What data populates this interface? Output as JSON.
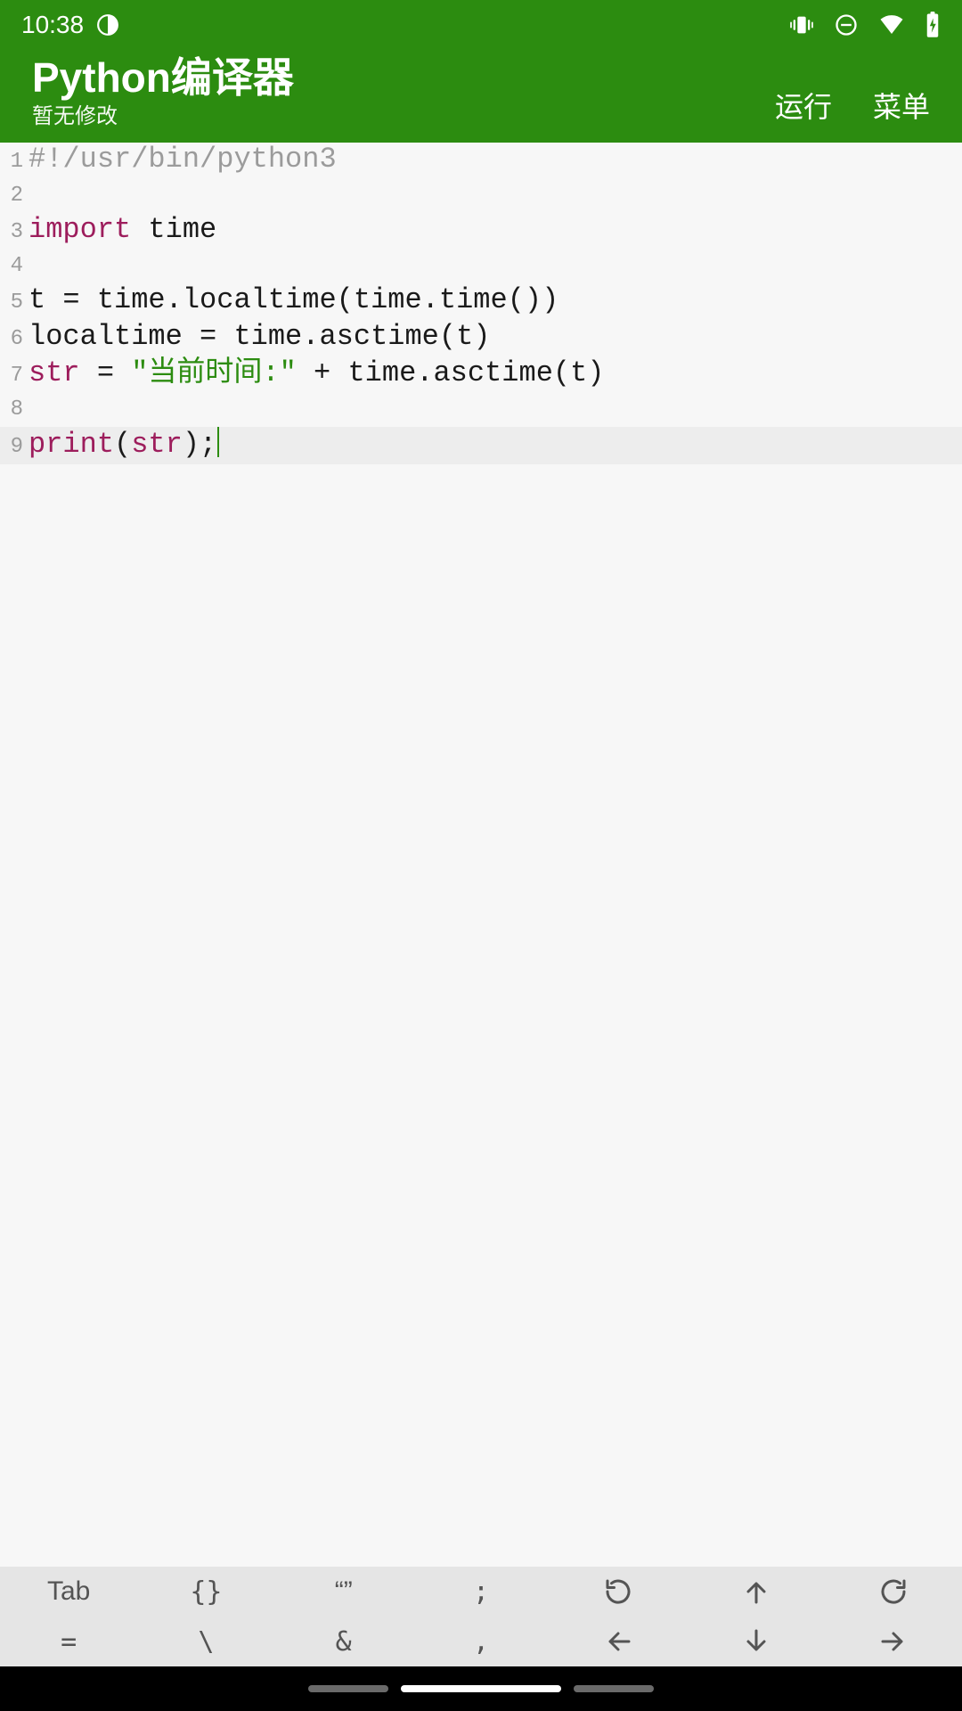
{
  "status": {
    "time": "10:38"
  },
  "appbar": {
    "title": "Python编译器",
    "subtitle": "暂无修改",
    "run_label": "运行",
    "menu_label": "菜单"
  },
  "code": {
    "lines": [
      {
        "n": "1",
        "type": "comment",
        "full": "#!/usr/bin/python3"
      },
      {
        "n": "2",
        "type": "blank"
      },
      {
        "n": "3",
        "type": "import",
        "kw": "import",
        "rest": " time"
      },
      {
        "n": "4",
        "type": "blank"
      },
      {
        "n": "5",
        "type": "plain",
        "text": "t = time.localtime(time.time())"
      },
      {
        "n": "6",
        "type": "plain",
        "text": "localtime = time.asctime(t)"
      },
      {
        "n": "7",
        "type": "assign_str",
        "lhs": "str",
        "eq": " = ",
        "str": "\"当前时间:\"",
        "rest": " + time.asctime(t)"
      },
      {
        "n": "8",
        "type": "blank"
      },
      {
        "n": "9",
        "type": "print",
        "fn": "print",
        "open": "(",
        "arg": "str",
        "close": ");",
        "current": true
      }
    ]
  },
  "keyboard": {
    "row1": [
      "Tab",
      "{}",
      "“”",
      ";",
      "undo",
      "up",
      "redo"
    ],
    "row2": [
      "=",
      "\\",
      "&",
      ",",
      "left",
      "down",
      "right"
    ]
  }
}
